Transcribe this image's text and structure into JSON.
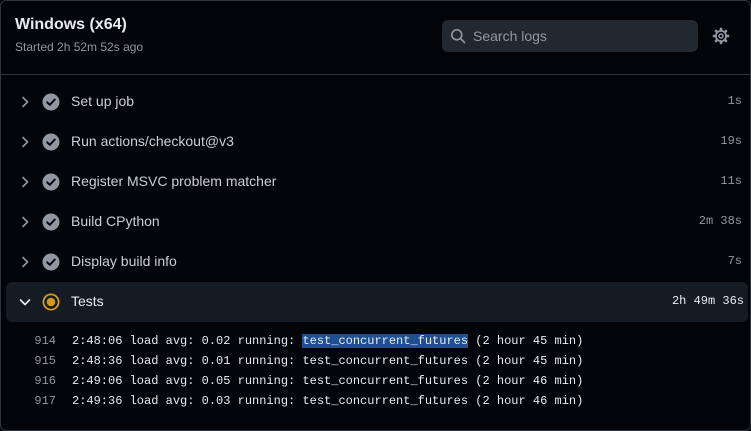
{
  "header": {
    "title": "Windows (x64)",
    "subtitle": "Started 2h 52m 52s ago",
    "search_placeholder": "Search logs"
  },
  "steps": [
    {
      "name": "Set up job",
      "duration": "1s",
      "status": "success"
    },
    {
      "name": "Run actions/checkout@v3",
      "duration": "19s",
      "status": "success"
    },
    {
      "name": "Register MSVC problem matcher",
      "duration": "11s",
      "status": "success"
    },
    {
      "name": "Build CPython",
      "duration": "2m 38s",
      "status": "success"
    },
    {
      "name": "Display build info",
      "duration": "7s",
      "status": "success"
    },
    {
      "name": "Tests",
      "duration": "2h 49m 36s",
      "status": "in_progress"
    }
  ],
  "log": {
    "search_match": "test_concurrent_futures",
    "lines": [
      {
        "num": "914",
        "pre": "2:48:06 load avg: 0.02 running: ",
        "match": "test_concurrent_futures",
        "post": " (2 hour 45 min)"
      },
      {
        "num": "915",
        "pre": "2:48:36 load avg: 0.01 running: ",
        "match": "test_concurrent_futures",
        "post": " (2 hour 45 min)"
      },
      {
        "num": "916",
        "pre": "2:49:06 load avg: 0.05 running: ",
        "match": "test_concurrent_futures",
        "post": " (2 hour 46 min)"
      },
      {
        "num": "917",
        "pre": "2:49:36 load avg: 0.03 running: ",
        "match": "test_concurrent_futures",
        "post": " (2 hour 46 min)"
      }
    ]
  },
  "colors": {
    "background": "#010409",
    "success": "#9198a1",
    "in_progress": "#d29922",
    "highlight": "#1f4f8f"
  }
}
